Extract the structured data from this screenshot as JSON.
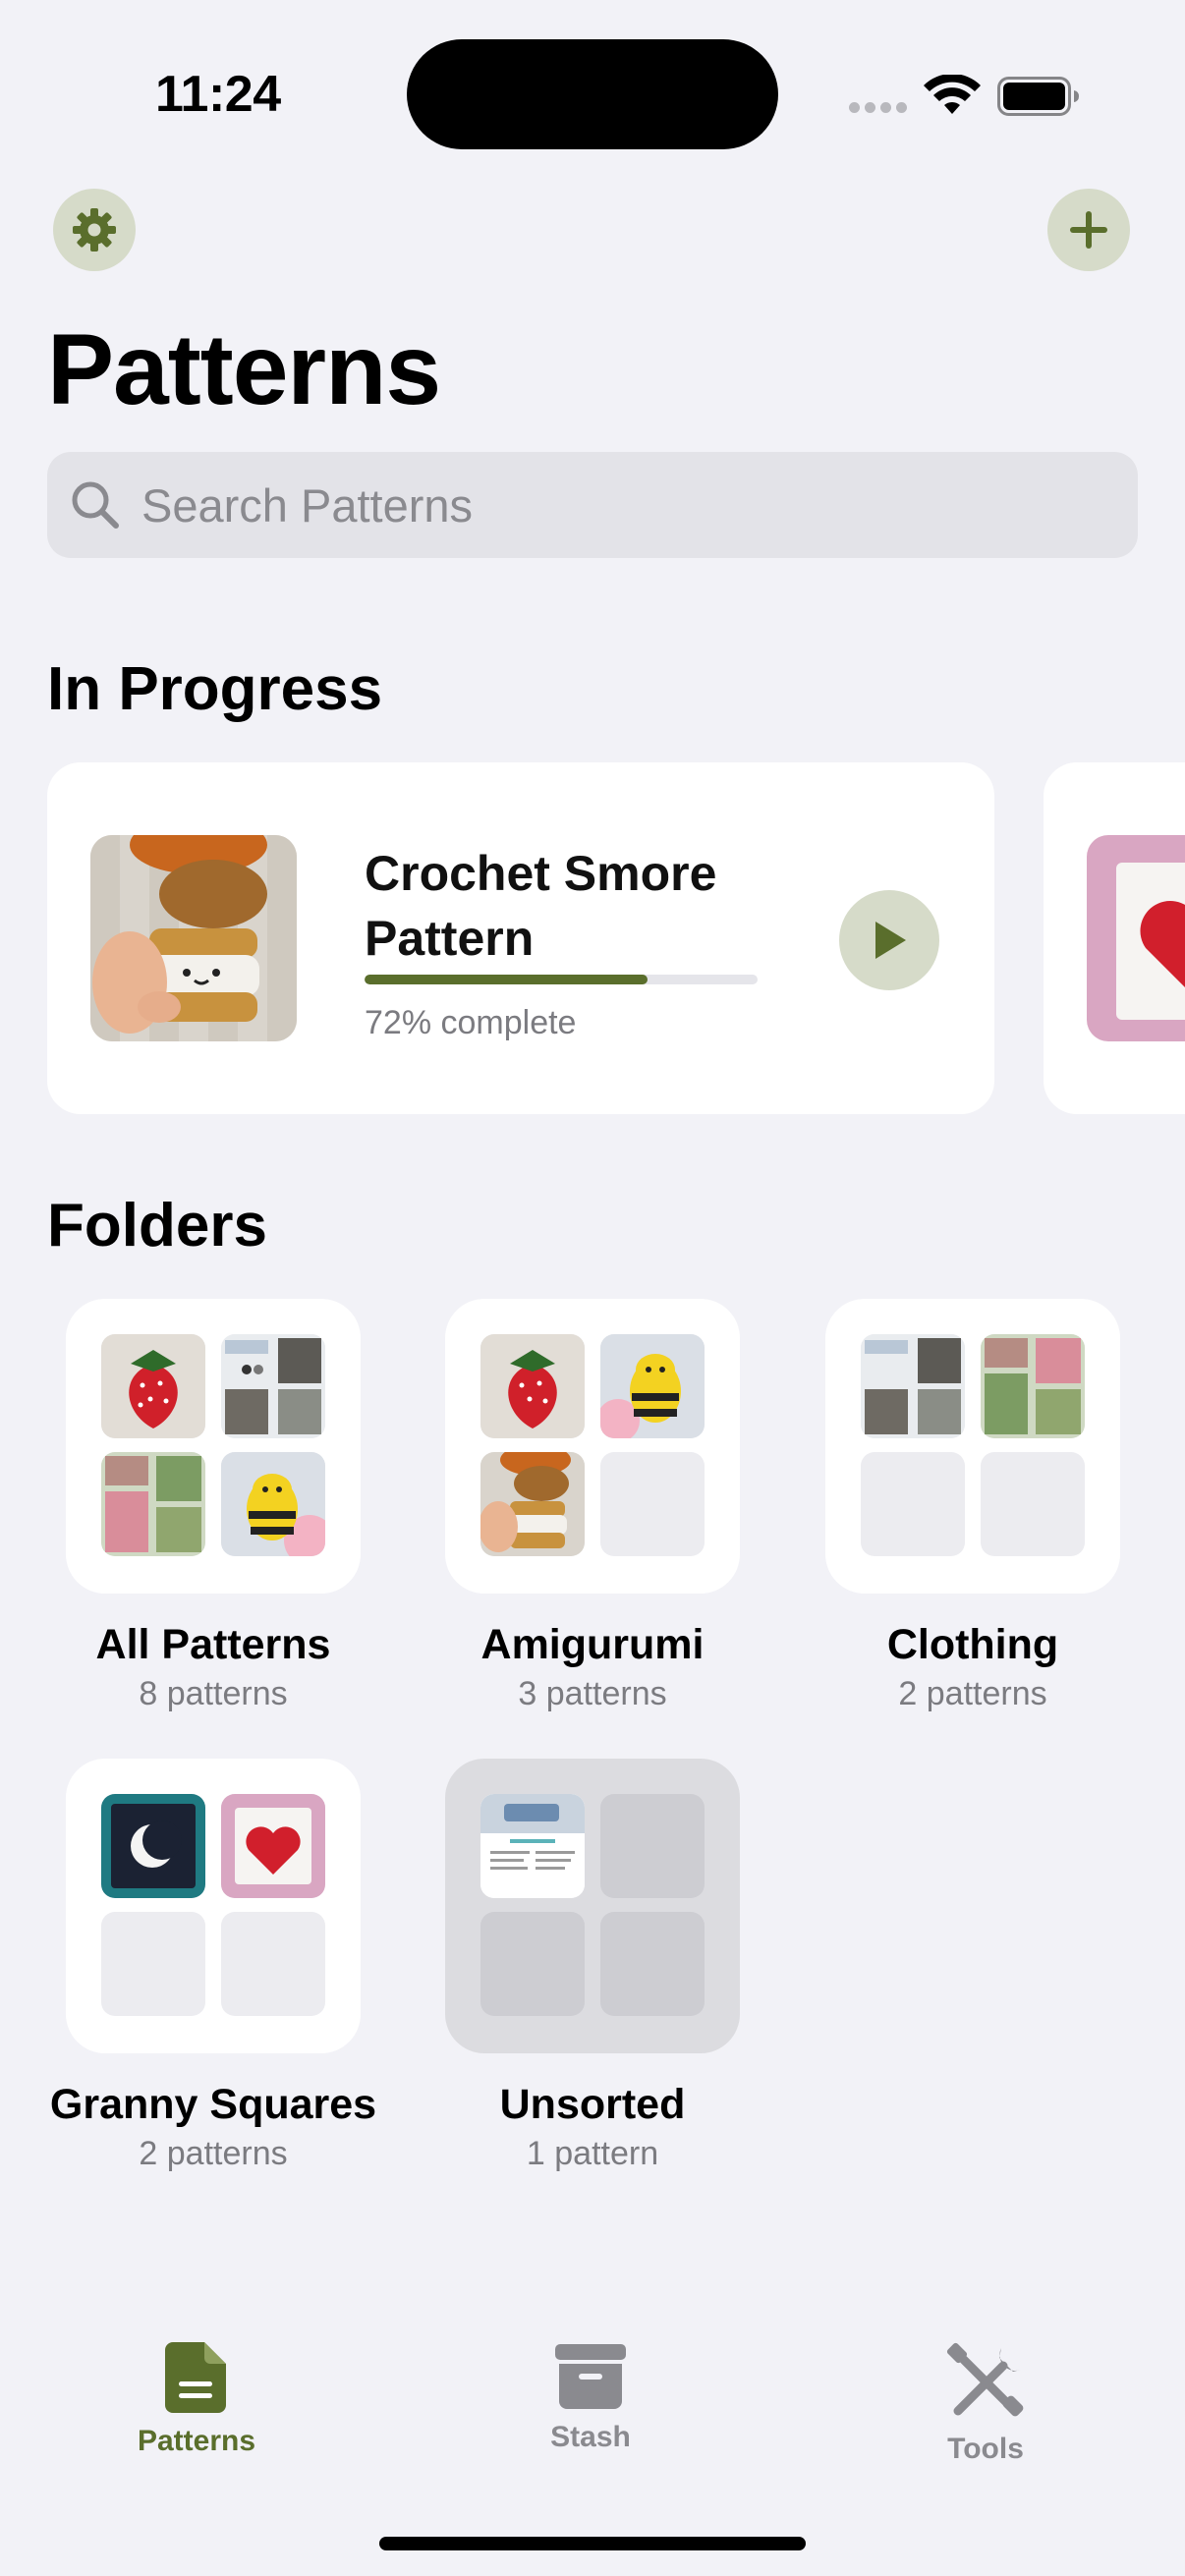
{
  "status_bar": {
    "time": "11:24"
  },
  "header": {
    "title": "Patterns"
  },
  "search": {
    "placeholder": "Search Patterns"
  },
  "in_progress": {
    "title": "In Progress",
    "items": [
      {
        "name": "Crochet Smore Pattern",
        "progress": 0.72,
        "progress_label": "72% complete"
      }
    ]
  },
  "folders": {
    "title": "Folders",
    "items": [
      {
        "name": "All Patterns",
        "count": "8 patterns"
      },
      {
        "name": "Amigurumi",
        "count": "3 patterns"
      },
      {
        "name": "Clothing",
        "count": "2 patterns"
      },
      {
        "name": "Granny Squares",
        "count": "2 patterns"
      },
      {
        "name": "Unsorted",
        "count": "1 pattern"
      }
    ]
  },
  "tab_bar": {
    "items": [
      {
        "label": "Patterns",
        "icon": "document-icon",
        "active": true
      },
      {
        "label": "Stash",
        "icon": "archive-box-icon",
        "active": false
      },
      {
        "label": "Tools",
        "icon": "tools-icon",
        "active": false
      }
    ]
  },
  "colors": {
    "accent": "#5a6e2c",
    "accent_light": "#d6dbc9",
    "background": "#f2f2f7"
  }
}
